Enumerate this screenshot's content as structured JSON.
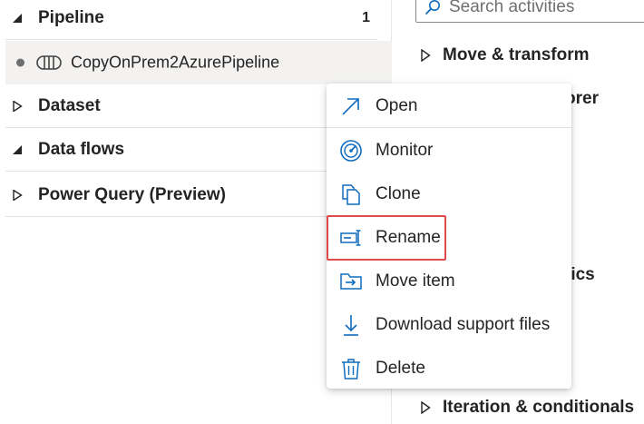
{
  "explorer": {
    "sections": [
      {
        "label": "Pipeline",
        "count": "1",
        "expanded": true
      },
      {
        "label": "Dataset",
        "expanded": false
      },
      {
        "label": "Data flows",
        "expanded": true
      },
      {
        "label": "Power Query (Preview)",
        "expanded": false
      }
    ],
    "pipeline_item": {
      "label": "CopyOnPrem2AzurePipeline"
    }
  },
  "activities": {
    "search_placeholder": "Search activities",
    "categories": [
      {
        "label": "Move & transform",
        "expanded": false
      },
      {
        "label": "Iteration & conditionals",
        "expanded": false
      }
    ],
    "peek_texts": [
      "orer",
      "tics"
    ]
  },
  "context_menu": {
    "items": [
      {
        "label": "Open",
        "icon": "open-arrow-icon"
      },
      {
        "label": "Monitor",
        "icon": "monitor-gauge-icon"
      },
      {
        "label": "Clone",
        "icon": "clone-icon"
      },
      {
        "label": "Rename",
        "icon": "rename-icon",
        "highlighted": true
      },
      {
        "label": "Move item",
        "icon": "move-item-icon"
      },
      {
        "label": "Download support files",
        "icon": "download-icon"
      },
      {
        "label": "Delete",
        "icon": "delete-trash-icon"
      }
    ]
  },
  "colors": {
    "accent": "#0f6cbd",
    "highlight_border": "#e04c4c",
    "selected_row": "#f3f2f1"
  }
}
